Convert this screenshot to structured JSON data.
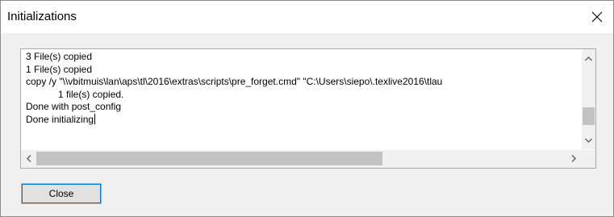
{
  "window": {
    "title": "Initializations"
  },
  "log": {
    "lines": [
      "3 File(s) copied",
      "1 File(s) copied",
      "copy /y \"\\\\vbitmuis\\lan\\aps\\tl\\2016\\extras\\scripts\\pre_forget.cmd\" \"C:\\Users\\siepo\\.texlive2016\\tlau",
      "1 file(s) copied.",
      "Done with post_config",
      "Done initializing"
    ]
  },
  "buttons": {
    "close_label": "Close"
  },
  "icons": {
    "window_close": "close-x-icon",
    "scroll_up": "chevron-up-icon",
    "scroll_down": "chevron-down-icon",
    "scroll_left": "chevron-left-icon",
    "scroll_right": "chevron-right-icon"
  },
  "colors": {
    "focus_border": "#0078d7",
    "window_bg": "#f0f0f0",
    "scroll_thumb": "#c2c2c2"
  }
}
